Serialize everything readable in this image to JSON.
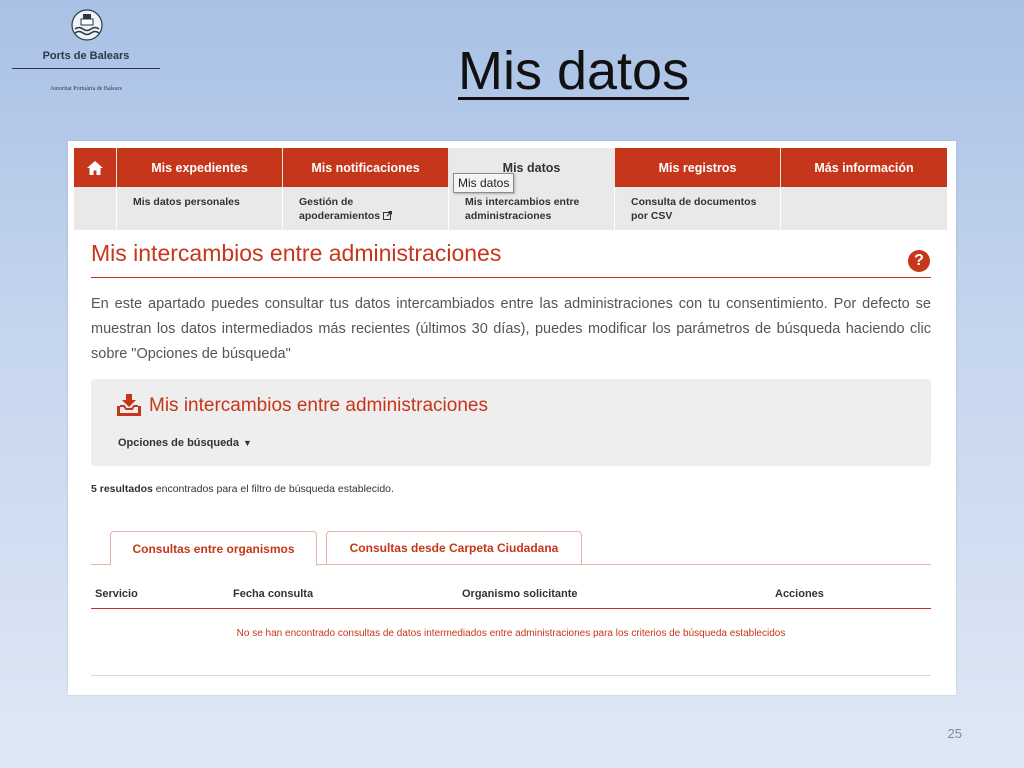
{
  "logo": {
    "name": "Ports de Balears",
    "subtitle": "Autoritat Portuària de Balears"
  },
  "slide": {
    "title": "Mis datos",
    "page_number": "25"
  },
  "nav": {
    "home_icon": "home-icon",
    "items": [
      {
        "label": "Mis expedientes"
      },
      {
        "label": "Mis notificaciones"
      },
      {
        "label": "Mis datos"
      },
      {
        "label": "Mis registros"
      },
      {
        "label": "Más información"
      }
    ],
    "sub_items": [
      {
        "label": "Mis datos personales"
      },
      {
        "label": "Gestión de apoderamientos"
      },
      {
        "label": "Mis intercambios entre administraciones"
      },
      {
        "label": "Consulta de documentos por CSV"
      },
      {
        "label": ""
      }
    ],
    "tooltip": "Mis datos"
  },
  "content": {
    "title": "Mis intercambios entre administraciones",
    "help_icon": "help-icon",
    "description": "En este apartado puedes consultar tus datos intercambiados entre las administraciones con tu consentimiento. Por defecto se muestran los datos intermediados más recientes (últimos 30 días), puedes modificar los parámetros de búsqueda haciendo clic sobre \"Opciones de búsqueda\"",
    "search_box": {
      "icon": "inbox-download-icon",
      "title": "Mis intercambios entre administraciones",
      "options_label": "Opciones de búsqueda",
      "options_caret": "▼"
    },
    "results": {
      "count": "5 resultados",
      "text": " encontrados para el filtro de búsqueda establecido."
    },
    "tabs": [
      {
        "label": "Consultas entre organismos",
        "active": true
      },
      {
        "label": "Consultas desde Carpeta Ciudadana",
        "active": false
      }
    ],
    "table": {
      "headers": [
        "Servicio",
        "Fecha consulta",
        "Organismo solicitante",
        "Acciones"
      ],
      "empty_message": "No se han encontrado consultas de datos intermediados entre administraciones para los criterios de búsqueda establecidos"
    }
  },
  "colors": {
    "accent": "#c6361a",
    "nav_active": "#e9e9e9",
    "slide_background": "#b8cdea"
  }
}
